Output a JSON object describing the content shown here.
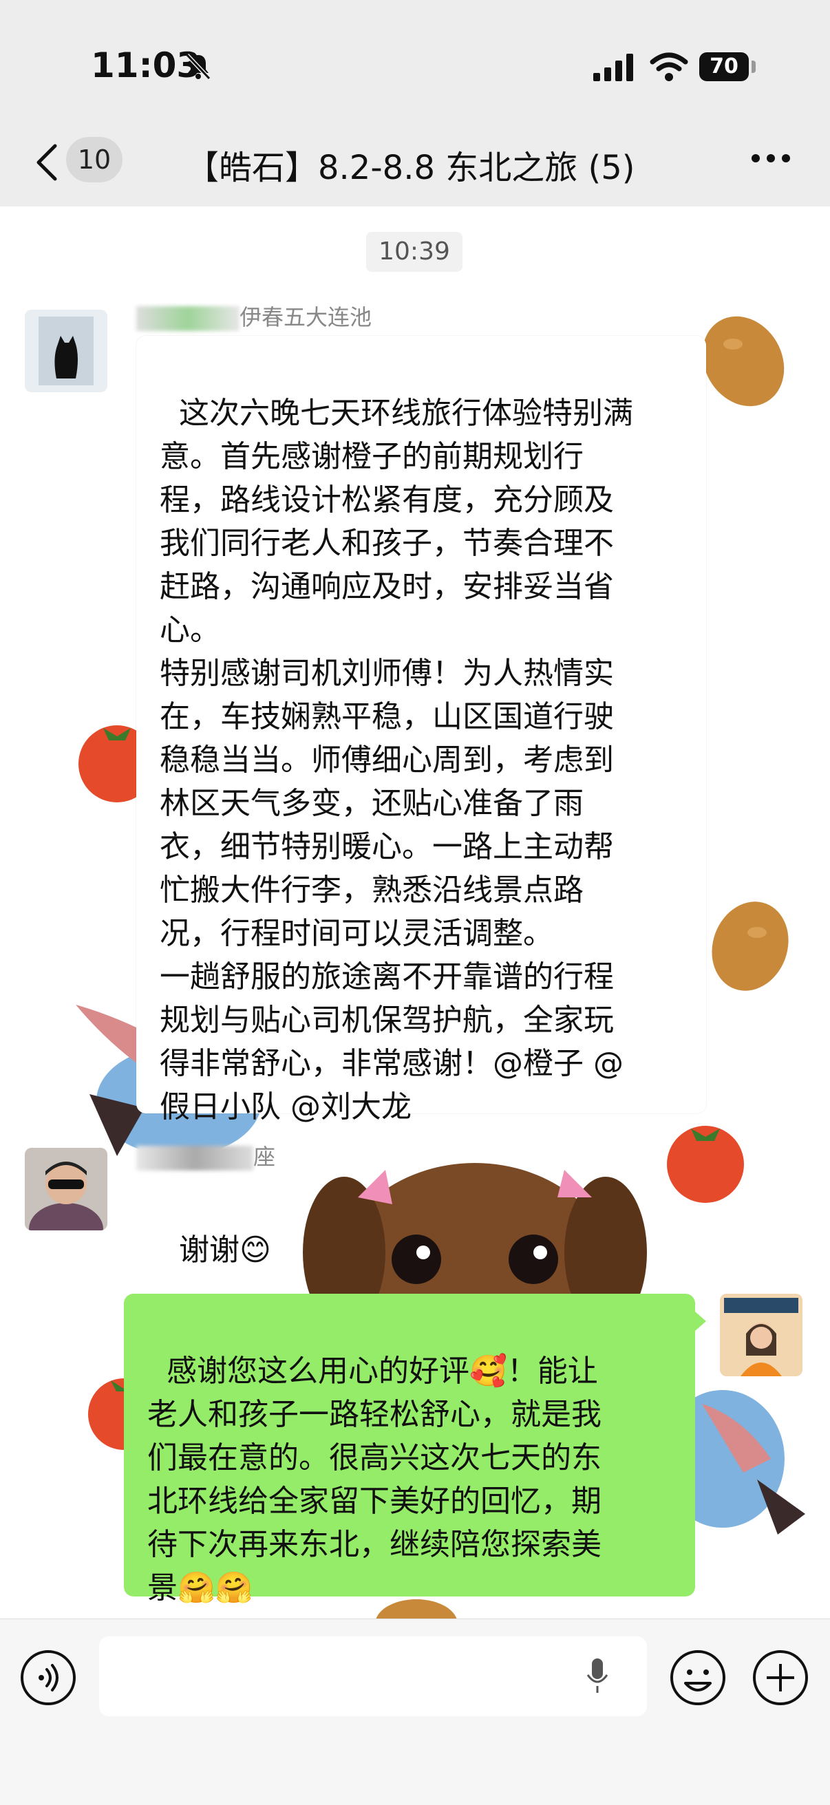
{
  "status_bar": {
    "time": "11:03",
    "battery": "70"
  },
  "header": {
    "unread_count": "10",
    "title": "【皓石】8.2-8.8 东北之旅 (5)"
  },
  "chat": {
    "timestamp": "10:39",
    "messages": [
      {
        "sender_visible": "伊春五大连池",
        "text": "这次六晚七天环线旅行体验特别满\n意。首先感谢橙子的前期规划行\n程，路线设计松紧有度，充分顾及\n我们同行老人和孩子，节奏合理不\n赶路，沟通响应及时，安排妥当省\n心。\n特别感谢司机刘师傅！为人热情实\n在，车技娴熟平稳，山区国道行驶\n稳稳当当。师傅细心周到，考虑到\n林区天气多变，还贴心准备了雨\n衣，细节特别暖心。一路上主动帮\n忙搬大件行李，熟悉沿线景点路\n况，行程时间可以灵活调整。\n一趟舒服的旅途离不开靠谱的行程\n规划与贴心司机保驾护航，全家玩\n得非常舒心，非常感谢！@橙子 @\n假日小队 @刘大龙"
      },
      {
        "sender_visible": "座",
        "text": "谢谢😊"
      },
      {
        "text": "感谢您这么用心的好评🥰！能让\n老人和孩子一路轻松舒心，就是我\n们最在意的。很高兴这次七天的东\n北环线给全家留下美好的回忆，期\n待下次再来东北，继续陪您探索美\n景🤗🤗"
      }
    ]
  },
  "colors": {
    "self_bubble": "#95ec69",
    "background": "#ededed"
  }
}
